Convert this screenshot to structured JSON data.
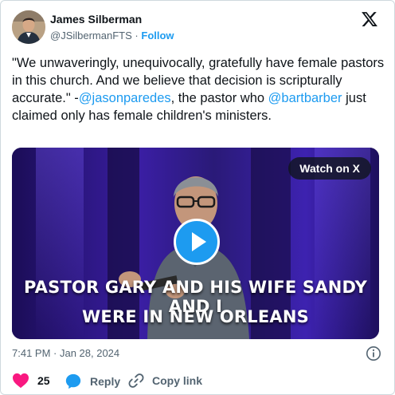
{
  "author": {
    "name": "James Silberman",
    "handle": "@JSilbermanFTS",
    "separator": "·",
    "follow_label": "Follow"
  },
  "tweet": {
    "text_part1": "\"We unwaveringly, unequivocally, gratefully have female pastors in this church. And we believe that decision is scripturally accurate.\" -",
    "mention1": "@jasonparedes",
    "text_part2": ", the pastor who ",
    "mention2": "@bartbarber",
    "text_part3": " just claimed only has female children's ministers."
  },
  "media": {
    "watch_label": "Watch on X",
    "caption_line1": "PASTOR GARY AND HIS WIFE SANDY AND I",
    "caption_line2": "WERE IN NEW ORLEANS"
  },
  "timestamp": "7:41 PM · Jan 28, 2024",
  "actions": {
    "like_count": "25",
    "reply_label": "Reply",
    "copy_label": "Copy link"
  },
  "colors": {
    "accent": "#1d9bf0",
    "like": "#f91880",
    "secondary_text": "#536471"
  },
  "icons": [
    "x-logo-icon",
    "play-icon",
    "info-icon",
    "heart-icon",
    "reply-bubble-icon",
    "link-icon"
  ]
}
